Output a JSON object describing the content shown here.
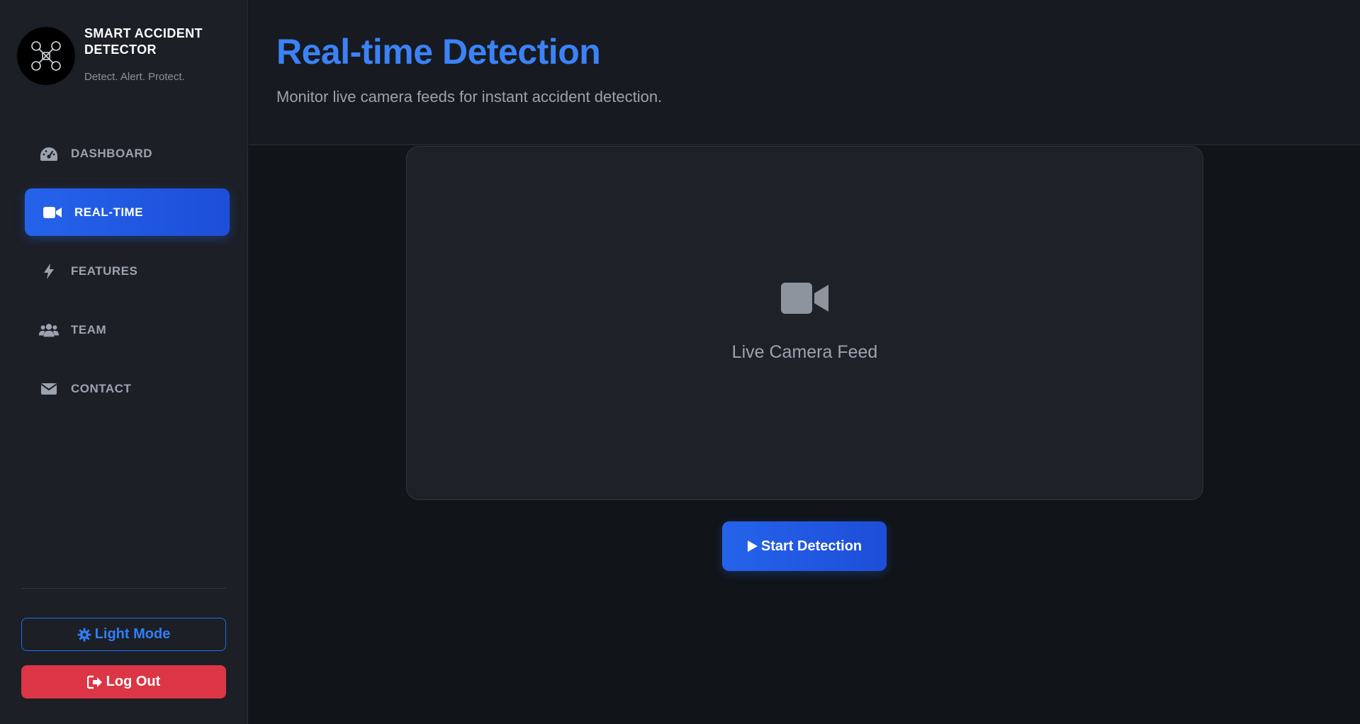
{
  "brand": {
    "title": "SMART ACCIDENT DETECTOR",
    "tagline": "Detect. Alert. Protect.",
    "logo_icon": "drone-icon"
  },
  "sidebar": {
    "items": [
      {
        "label": "DASHBOARD",
        "icon": "gauge-icon",
        "active": false
      },
      {
        "label": "REAL-TIME",
        "icon": "video-camera-icon",
        "active": true
      },
      {
        "label": "FEATURES",
        "icon": "bolt-icon",
        "active": false
      },
      {
        "label": "TEAM",
        "icon": "users-icon",
        "active": false
      },
      {
        "label": "CONTACT",
        "icon": "envelope-icon",
        "active": false
      }
    ],
    "light_mode_label": "Light Mode",
    "logout_label": "Log Out"
  },
  "header": {
    "title": "Real-time Detection",
    "subtitle": "Monitor live camera feeds for instant accident detection."
  },
  "feed": {
    "label": "Live Camera Feed",
    "icon": "video-camera-icon"
  },
  "actions": {
    "start_label": "Start Detection"
  },
  "colors": {
    "accent": "#2563eb",
    "title": "#3b82f6",
    "danger": "#dc3545",
    "sidebar_bg": "#1c1f26",
    "page_bg": "#111418"
  }
}
